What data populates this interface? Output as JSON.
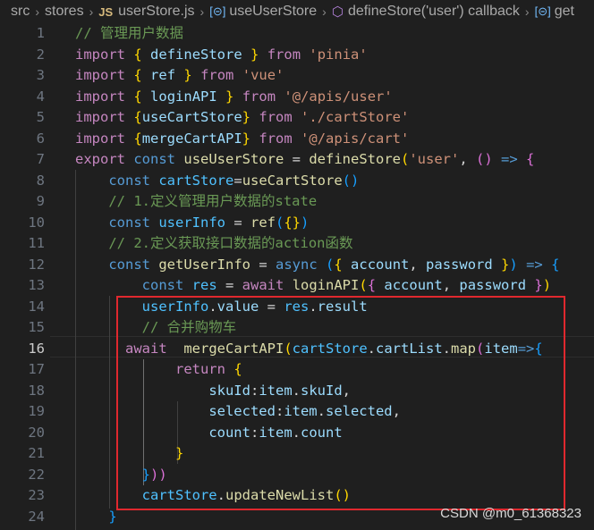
{
  "breadcrumb": {
    "items": [
      "src",
      "stores",
      "userStore.js",
      "useUserStore",
      "defineStore('user') callback",
      "get"
    ],
    "file_icon": "JS"
  },
  "editor": {
    "active_line": 16,
    "lines": [
      {
        "n": "1",
        "tokens": [
          [
            "// 管理用户数据",
            "cm"
          ]
        ]
      },
      {
        "n": "2",
        "tokens": [
          [
            "import",
            "kw"
          ],
          [
            " ",
            "p"
          ],
          [
            "{",
            "b1"
          ],
          [
            " ",
            "p"
          ],
          [
            "defineStore",
            "var"
          ],
          [
            " ",
            "p"
          ],
          [
            "}",
            "b1"
          ],
          [
            " ",
            "p"
          ],
          [
            "from",
            "kw"
          ],
          [
            " ",
            "p"
          ],
          [
            "'pinia'",
            "str"
          ]
        ]
      },
      {
        "n": "3",
        "tokens": [
          [
            "import",
            "kw"
          ],
          [
            " ",
            "p"
          ],
          [
            "{",
            "b1"
          ],
          [
            " ",
            "p"
          ],
          [
            "ref",
            "var"
          ],
          [
            " ",
            "p"
          ],
          [
            "}",
            "b1"
          ],
          [
            " ",
            "p"
          ],
          [
            "from",
            "kw"
          ],
          [
            " ",
            "p"
          ],
          [
            "'vue'",
            "str"
          ]
        ]
      },
      {
        "n": "4",
        "tokens": [
          [
            "import",
            "kw"
          ],
          [
            " ",
            "p"
          ],
          [
            "{",
            "b1"
          ],
          [
            " ",
            "p"
          ],
          [
            "loginAPI",
            "var"
          ],
          [
            " ",
            "p"
          ],
          [
            "}",
            "b1"
          ],
          [
            " ",
            "p"
          ],
          [
            "from",
            "kw"
          ],
          [
            " ",
            "p"
          ],
          [
            "'@/apis/user'",
            "str"
          ]
        ]
      },
      {
        "n": "5",
        "tokens": [
          [
            "import",
            "kw"
          ],
          [
            " ",
            "p"
          ],
          [
            "{",
            "b1"
          ],
          [
            "useCartStore",
            "var"
          ],
          [
            "}",
            "b1"
          ],
          [
            " ",
            "p"
          ],
          [
            "from",
            "kw"
          ],
          [
            " ",
            "p"
          ],
          [
            "'./cartStore'",
            "str"
          ]
        ]
      },
      {
        "n": "6",
        "tokens": [
          [
            "import",
            "kw"
          ],
          [
            " ",
            "p"
          ],
          [
            "{",
            "b1"
          ],
          [
            "mergeCartAPI",
            "var"
          ],
          [
            "}",
            "b1"
          ],
          [
            " ",
            "p"
          ],
          [
            "from",
            "kw"
          ],
          [
            " ",
            "p"
          ],
          [
            "'@/apis/cart'",
            "str"
          ]
        ]
      },
      {
        "n": "7",
        "tokens": [
          [
            "export",
            "kw"
          ],
          [
            " ",
            "p"
          ],
          [
            "const",
            "decl"
          ],
          [
            " ",
            "p"
          ],
          [
            "useUserStore",
            "fn"
          ],
          [
            " = ",
            "p"
          ],
          [
            "defineStore",
            "fn"
          ],
          [
            "(",
            "b1"
          ],
          [
            "'user'",
            "str"
          ],
          [
            ", ",
            "p"
          ],
          [
            "()",
            "b2"
          ],
          [
            " ",
            "p"
          ],
          [
            "=>",
            "decl"
          ],
          [
            " ",
            "p"
          ],
          [
            "{",
            "b2"
          ]
        ]
      },
      {
        "n": "8",
        "tokens": [
          [
            "    ",
            "p"
          ],
          [
            "const",
            "decl"
          ],
          [
            " ",
            "p"
          ],
          [
            "cartStore",
            "const"
          ],
          [
            "=",
            "p"
          ],
          [
            "useCartStore",
            "fn"
          ],
          [
            "()",
            "b3"
          ]
        ]
      },
      {
        "n": "9",
        "tokens": [
          [
            "    ",
            "p"
          ],
          [
            "// 1.定义管理用户数据的state",
            "cm"
          ]
        ]
      },
      {
        "n": "10",
        "tokens": [
          [
            "    ",
            "p"
          ],
          [
            "const",
            "decl"
          ],
          [
            " ",
            "p"
          ],
          [
            "userInfo",
            "const"
          ],
          [
            " = ",
            "p"
          ],
          [
            "ref",
            "fn"
          ],
          [
            "(",
            "b3"
          ],
          [
            "{}",
            "b1"
          ],
          [
            ")",
            "b3"
          ]
        ]
      },
      {
        "n": "11",
        "tokens": [
          [
            "    ",
            "p"
          ],
          [
            "// 2.定义获取接口数据的action函数",
            "cm"
          ]
        ]
      },
      {
        "n": "12",
        "tokens": [
          [
            "    ",
            "p"
          ],
          [
            "const",
            "decl"
          ],
          [
            " ",
            "p"
          ],
          [
            "getUserInfo",
            "fn"
          ],
          [
            " = ",
            "p"
          ],
          [
            "async",
            "decl"
          ],
          [
            " ",
            "p"
          ],
          [
            "(",
            "b3"
          ],
          [
            "{",
            "b1"
          ],
          [
            " ",
            "p"
          ],
          [
            "account",
            "var"
          ],
          [
            ", ",
            "p"
          ],
          [
            "password",
            "var"
          ],
          [
            " ",
            "p"
          ],
          [
            "}",
            "b1"
          ],
          [
            ")",
            "b3"
          ],
          [
            " ",
            "p"
          ],
          [
            "=>",
            "decl"
          ],
          [
            " ",
            "p"
          ],
          [
            "{",
            "b3"
          ]
        ]
      },
      {
        "n": "13",
        "tokens": [
          [
            "        ",
            "p"
          ],
          [
            "const",
            "decl"
          ],
          [
            " ",
            "p"
          ],
          [
            "res",
            "const"
          ],
          [
            " = ",
            "p"
          ],
          [
            "await",
            "kw"
          ],
          [
            " ",
            "p"
          ],
          [
            "loginAPI",
            "fn"
          ],
          [
            "(",
            "b1"
          ],
          [
            "{",
            "b2"
          ],
          [
            " ",
            "p"
          ],
          [
            "account",
            "var"
          ],
          [
            ", ",
            "p"
          ],
          [
            "password",
            "var"
          ],
          [
            " ",
            "p"
          ],
          [
            "}",
            "b2"
          ],
          [
            ")",
            "b1"
          ]
        ]
      },
      {
        "n": "14",
        "tokens": [
          [
            "        ",
            "p"
          ],
          [
            "userInfo",
            "const"
          ],
          [
            ".",
            "p"
          ],
          [
            "value",
            "var"
          ],
          [
            " = ",
            "p"
          ],
          [
            "res",
            "const"
          ],
          [
            ".",
            "p"
          ],
          [
            "result",
            "var"
          ]
        ]
      },
      {
        "n": "15",
        "tokens": [
          [
            "        ",
            "p"
          ],
          [
            "// 合并购物车",
            "cm"
          ]
        ]
      },
      {
        "n": "16",
        "tokens": [
          [
            "await",
            "kw"
          ],
          [
            "  ",
            "p"
          ],
          [
            "mergeCartAPI",
            "fn"
          ],
          [
            "(",
            "b1"
          ],
          [
            "cartStore",
            "const"
          ],
          [
            ".",
            "p"
          ],
          [
            "cartList",
            "var"
          ],
          [
            ".",
            "p"
          ],
          [
            "map",
            "fn"
          ],
          [
            "(",
            "b2"
          ],
          [
            "item",
            "var"
          ],
          [
            "=>",
            "decl"
          ],
          [
            "{",
            "b3"
          ]
        ]
      },
      {
        "n": "17",
        "tokens": [
          [
            "            ",
            "p"
          ],
          [
            "return",
            "kw"
          ],
          [
            " ",
            "p"
          ],
          [
            "{",
            "b1"
          ]
        ]
      },
      {
        "n": "18",
        "tokens": [
          [
            "                ",
            "p"
          ],
          [
            "skuId",
            "var"
          ],
          [
            ":",
            "p"
          ],
          [
            "item",
            "var"
          ],
          [
            ".",
            "p"
          ],
          [
            "skuId",
            "var"
          ],
          [
            ",",
            "p"
          ]
        ]
      },
      {
        "n": "19",
        "tokens": [
          [
            "                ",
            "p"
          ],
          [
            "selected",
            "var"
          ],
          [
            ":",
            "p"
          ],
          [
            "item",
            "var"
          ],
          [
            ".",
            "p"
          ],
          [
            "selected",
            "var"
          ],
          [
            ",",
            "p"
          ]
        ]
      },
      {
        "n": "20",
        "tokens": [
          [
            "                ",
            "p"
          ],
          [
            "count",
            "var"
          ],
          [
            ":",
            "p"
          ],
          [
            "item",
            "var"
          ],
          [
            ".",
            "p"
          ],
          [
            "count",
            "var"
          ]
        ]
      },
      {
        "n": "21",
        "tokens": [
          [
            "            ",
            "p"
          ],
          [
            "}",
            "b1"
          ]
        ]
      },
      {
        "n": "22",
        "tokens": [
          [
            "        ",
            "p"
          ],
          [
            "}",
            "b3"
          ],
          [
            "))",
            "b2"
          ]
        ]
      },
      {
        "n": "23",
        "tokens": [
          [
            "        ",
            "p"
          ],
          [
            "cartStore",
            "const"
          ],
          [
            ".",
            "p"
          ],
          [
            "updateNewList",
            "fn"
          ],
          [
            "()",
            "b1"
          ]
        ]
      },
      {
        "n": "24",
        "tokens": [
          [
            "    ",
            "p"
          ],
          [
            "}",
            "b3"
          ]
        ]
      }
    ]
  },
  "watermark": "CSDN @m0_61368323",
  "colors": {
    "background": "#1f1f1f",
    "highlight_box": "#e0282e",
    "keyword": "#c586c0",
    "declaration": "#569cd6",
    "function": "#dcdcaa",
    "variable": "#9cdcfe",
    "constant": "#4fc1ff",
    "string": "#ce9178",
    "comment": "#6a9955"
  }
}
